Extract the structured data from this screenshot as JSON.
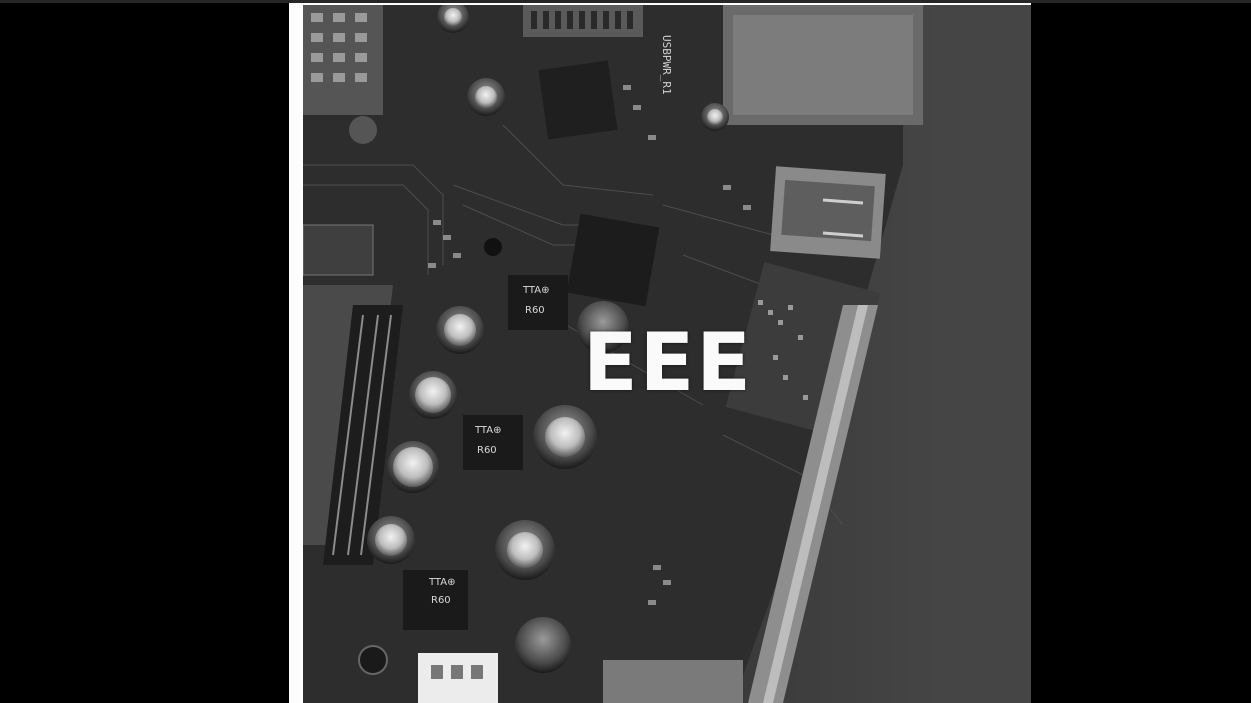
{
  "image": {
    "overlay_text": "EEE",
    "component_labels": {
      "header_label": "USBPWR_R1",
      "inductor_1_top": "TTA⊕",
      "inductor_1_bottom": "R60",
      "inductor_2_top": "TTA⊕",
      "inductor_2_bottom": "R60",
      "inductor_3_top": "TTA⊕",
      "inductor_3_bottom": "R60"
    }
  },
  "colors": {
    "background": "#000000",
    "frame": "#fdfdfd",
    "board": "#2a2a2a",
    "overlay_text": "#fafafa"
  }
}
